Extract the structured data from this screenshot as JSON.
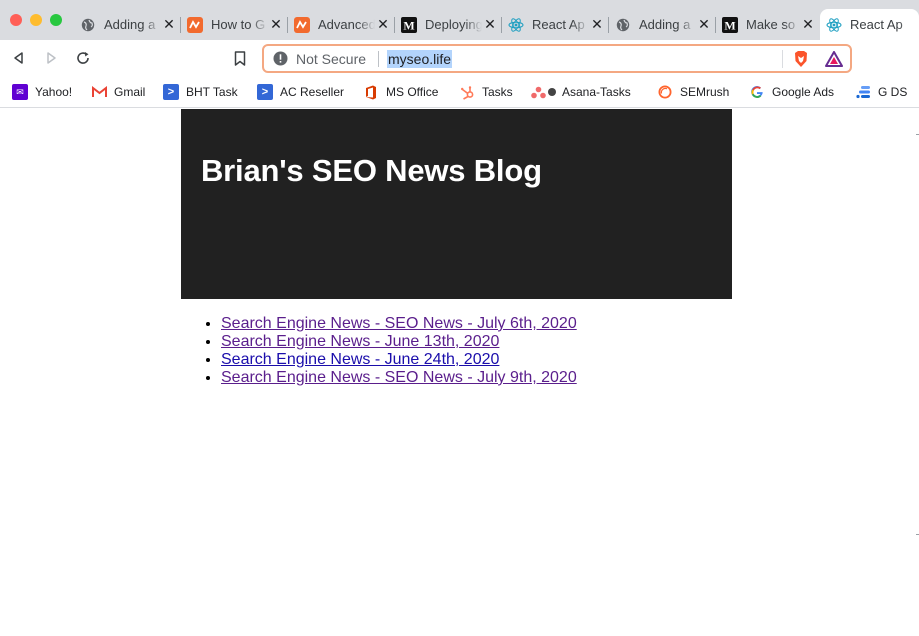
{
  "browser": {
    "tabs": [
      {
        "title": "Adding a",
        "favicon": "globe-icon",
        "active": false
      },
      {
        "title": "How to G",
        "favicon": "orange-n-icon",
        "active": false
      },
      {
        "title": "Advanced",
        "favicon": "orange-n-icon",
        "active": false
      },
      {
        "title": "Deploying",
        "favicon": "medium-icon",
        "active": false
      },
      {
        "title": "React Ap",
        "favicon": "react-icon",
        "active": false
      },
      {
        "title": "Adding a",
        "favicon": "globe-icon",
        "active": false
      },
      {
        "title": "Make so",
        "favicon": "medium-icon",
        "active": false
      },
      {
        "title": "React Ap",
        "favicon": "react-icon",
        "active": true
      }
    ],
    "address": {
      "security_label": "Not Secure",
      "url": "myseo.life"
    },
    "bookmarks": [
      {
        "label": "Yahoo!",
        "icon": "yahoo-icon"
      },
      {
        "label": "Gmail",
        "icon": "gmail-icon"
      },
      {
        "label": "BHT Task",
        "icon": "bht-icon"
      },
      {
        "label": "AC Reseller",
        "icon": "ac-icon"
      },
      {
        "label": "MS Office",
        "icon": "office-icon"
      },
      {
        "label": "Tasks",
        "icon": "hubspot-icon"
      },
      {
        "label": "Asana-Tasks",
        "icon": "asana-icon"
      },
      {
        "label": "SEMrush",
        "icon": "semrush-icon"
      },
      {
        "label": "Google Ads",
        "icon": "google-icon"
      },
      {
        "label": "G DS",
        "icon": "datastudio-icon"
      }
    ],
    "colors": {
      "omnibox_focus": "#f4a882",
      "url_highlight": "#b3d4fc"
    }
  },
  "page": {
    "title": "Brian's SEO News Blog",
    "posts": [
      {
        "label": "Search Engine News - SEO News - July 6th, 2020"
      },
      {
        "label": "Search Engine News - June 13th, 2020"
      },
      {
        "label": "Search Engine News - June 24th, 2020"
      },
      {
        "label": "Search Engine News - SEO News - July 9th, 2020"
      }
    ],
    "colors": {
      "hero_bg": "#212121",
      "visited_link": "#5a1e8c",
      "link": "#1a0dab"
    }
  }
}
